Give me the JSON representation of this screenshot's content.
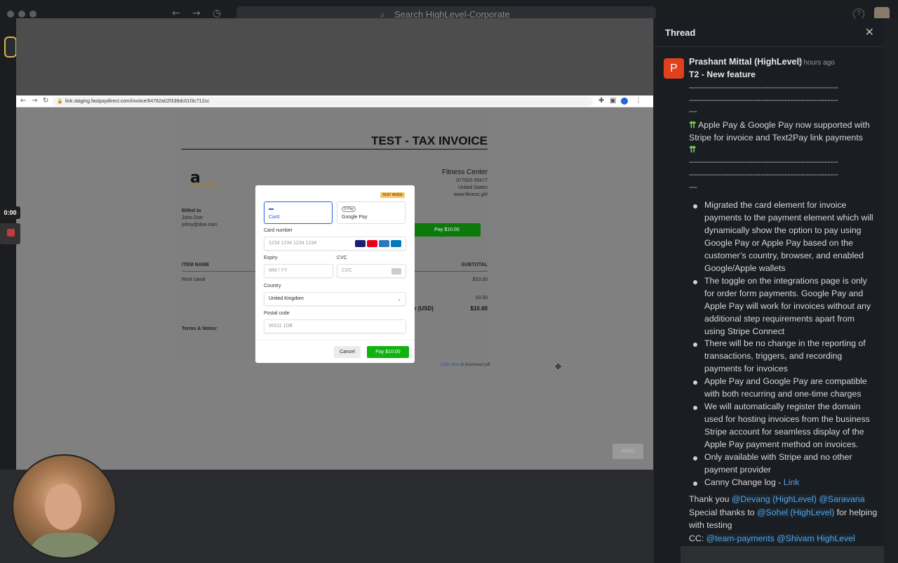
{
  "slack": {
    "search_placeholder": "Search HighLevel-Corporate",
    "help": "?"
  },
  "recording": {
    "timer": "0:00"
  },
  "browser": {
    "url": "link.staging.fastpaydirect.com/invoice/64782a02f338dc01f3c712cc"
  },
  "invoice": {
    "title": "TEST - TAX INVOICE",
    "logo_text": "a",
    "company": "Fitness Center",
    "company_lines": [
      "077920 05477",
      "United States",
      "www.fitness.ghl"
    ],
    "billed_to_label": "Billed to",
    "billed_to_name": "John Doe",
    "billed_to_email": "johny@doe.com",
    "pay_button": "Pay $10.00",
    "item_name_header": "ITEM NAME",
    "subtotal_header": "SUBTOTAL",
    "row_item": "Root canal",
    "row_amount": "$10.00",
    "row2_amount": "10.00",
    "total_label": "e (USD)",
    "total_amount": "$10.00",
    "terms_label": "Terms & Notes:",
    "download_link": "Click here",
    "download_text": " to download pdf"
  },
  "payment_modal": {
    "test_mode": "TEST MODE",
    "tab_card": "Card",
    "tab_gpay": "Google Pay",
    "gpay_icon_text": "G Pay",
    "card_number_label": "Card number",
    "card_number_placeholder": "1234 1234 1234 1234",
    "expiry_label": "Expiry",
    "expiry_placeholder": "MM / YY",
    "cvc_label": "CVC",
    "cvc_placeholder": "CVC",
    "country_label": "Country",
    "country_value": "United Kingdom",
    "postal_label": "Postal code",
    "postal_placeholder": "WS11 1DB",
    "cancel": "Cancel",
    "pay": "Pay $10.00",
    "brand_colors": [
      "#1a1f71",
      "#eb001b",
      "#2e77bc",
      "#0079be"
    ]
  },
  "miro_badge": "miro",
  "thread": {
    "title": "Thread",
    "author": "Prashant Mittal (HighLevel)",
    "time": "5 hours ago",
    "avatar_letter": "P",
    "heading": "T2 - New feature",
    "dashes": "--------------------------------------------------------",
    "dashes_short": "---",
    "announce_1": "Apple Pay & Google Pay now supported with",
    "announce_2": "Stripe for invoice and Text2Pay link payments",
    "bullets": [
      [
        "Migrated the card element for invoice",
        "payments to the payment element which will",
        "dynamically show the option to pay using",
        "Google Pay or Apple Pay based on the",
        "customer’s country, browser, and enabled",
        "Google/Apple wallets"
      ],
      [
        "The toggle on the integrations page is only",
        "for order form payments. Google Pay and",
        "Apple Pay will work for invoices without any",
        "additional step requirements apart from",
        "using Stripe Connect"
      ],
      [
        "There will be no change in the reporting of",
        "transactions, triggers, and recording",
        "payments for invoices"
      ],
      [
        "Apple Pay and Google Pay are compatible",
        "with both recurring and one-time charges"
      ],
      [
        "We will automatically register the domain",
        "used for hosting invoices from the business",
        "Stripe account for seamless display of the",
        "Apple Pay payment method on invoices."
      ],
      [
        "Only available with Stripe and no other",
        "payment provider"
      ]
    ],
    "canny_text": "Canny Change log - ",
    "canny_link": "Link",
    "thanks_text": "Thank you ",
    "mention_devang": "@Devang (HighLevel)",
    "mention_saravana": "@Saravana",
    "special_text": "Special thanks to ",
    "mention_sohel": "@Sohel (HighLevel)",
    "special_tail": " for helping",
    "special_tail2": "with testing",
    "cc_text": "CC: ",
    "mention_team": "@team-payments",
    "mention_shivam": "@Shivam HighLevel"
  }
}
